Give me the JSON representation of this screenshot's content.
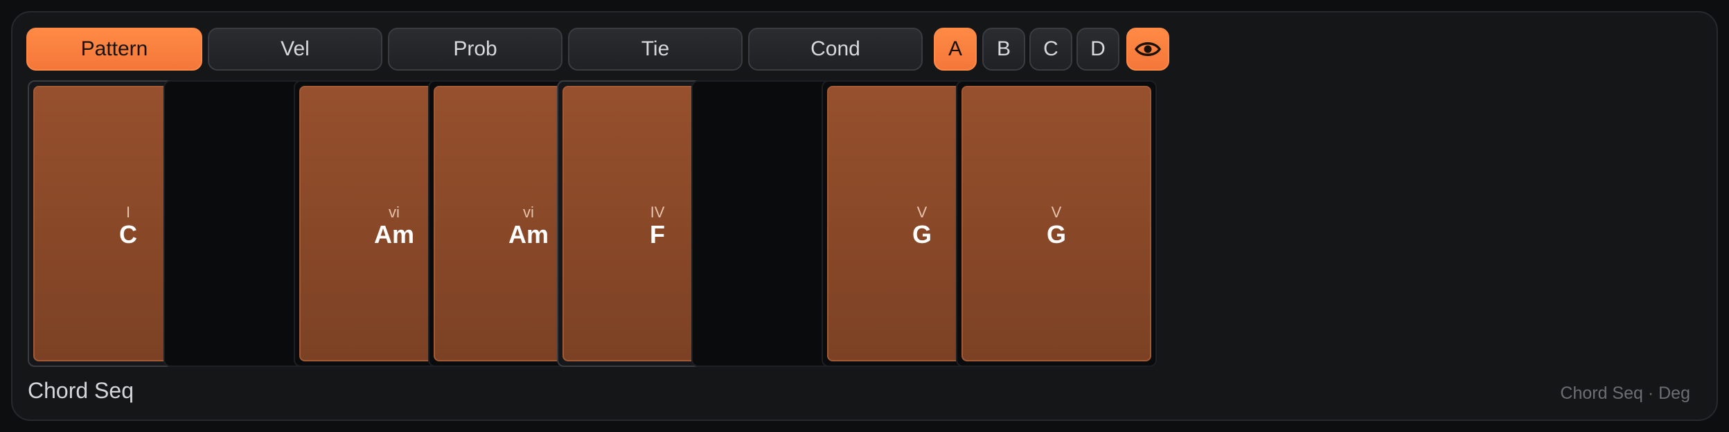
{
  "tabs": [
    {
      "label": "Pattern",
      "active": true
    },
    {
      "label": "Vel",
      "active": false
    },
    {
      "label": "Prob",
      "active": false
    },
    {
      "label": "Tie",
      "active": false
    },
    {
      "label": "Cond",
      "active": false
    }
  ],
  "banks": [
    {
      "label": "A",
      "active": true
    },
    {
      "label": "B",
      "active": false
    },
    {
      "label": "C",
      "active": false
    },
    {
      "label": "D",
      "active": false
    }
  ],
  "view_toggle": {
    "icon": "eye-icon",
    "active": true
  },
  "steps": [
    {
      "degree": "I",
      "chord": "C"
    },
    {
      "degree": "",
      "chord": ""
    },
    {
      "degree": "vi",
      "chord": "Am"
    },
    {
      "degree": "vi",
      "chord": "Am"
    },
    {
      "degree": "IV",
      "chord": "F"
    },
    {
      "degree": "",
      "chord": ""
    },
    {
      "degree": "V",
      "chord": "G"
    },
    {
      "degree": "V",
      "chord": "G"
    }
  ],
  "footer": {
    "title": "Chord Seq",
    "mode": "Chord Seq · Deg"
  },
  "colors": {
    "accent": "#f4773a",
    "chord_fill": "#8a4829",
    "background": "#151618"
  }
}
